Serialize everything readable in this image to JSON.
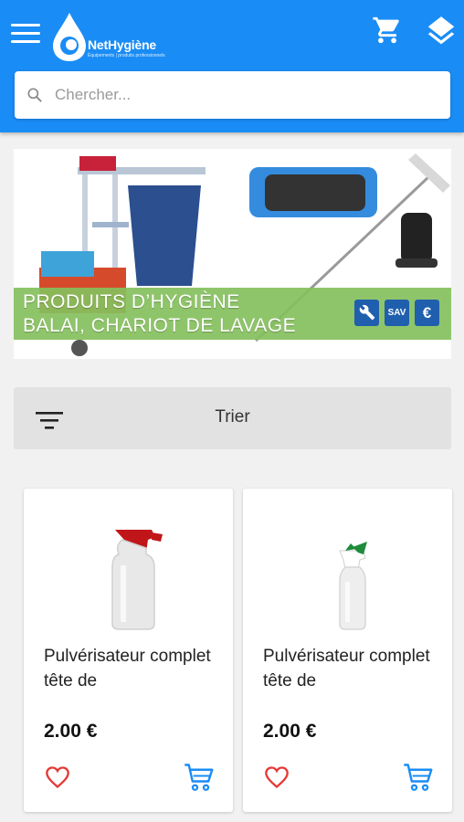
{
  "header": {
    "brand_name": "NetHygiène",
    "brand_tagline": "Équipements | produits professionnels",
    "menu_icon": "hamburger-menu-icon",
    "cart_icon": "shopping-cart-icon",
    "categories_icon": "layers-icon",
    "accent_color": "#1a8cf5"
  },
  "search": {
    "placeholder": "Chercher..."
  },
  "banner": {
    "line1": "PRODUITS D’HYGIÈNE",
    "line2": "BALAI, CHARIOT DE LAVAGE",
    "badges": [
      "SAV",
      "€"
    ],
    "badge_icons": [
      "wrench-icon"
    ]
  },
  "sort": {
    "label": "Trier",
    "icon": "sort-filter-icon"
  },
  "products": [
    {
      "name": "Pulvérisateur complet tête de",
      "price": "2.00 €",
      "nozzle_color": "#c0161a"
    },
    {
      "name": "Pulvérisateur complet tête de",
      "price": "2.00 €",
      "nozzle_color": "#1e8c3a"
    }
  ]
}
